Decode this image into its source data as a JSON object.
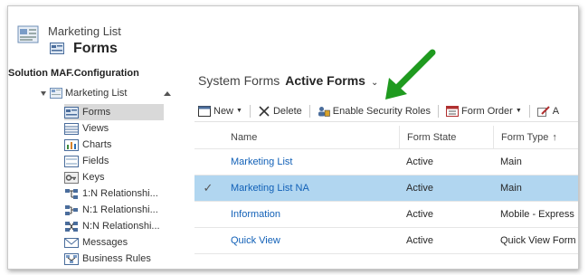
{
  "header": {
    "breadcrumb": "Marketing List",
    "title": "Forms"
  },
  "nav": {
    "solution_label": "Solution MAF.Configuration",
    "root_label": "Marketing List",
    "items": [
      {
        "label": "Forms",
        "icon": "forms-icon",
        "selected": true
      },
      {
        "label": "Views",
        "icon": "views-icon"
      },
      {
        "label": "Charts",
        "icon": "charts-icon"
      },
      {
        "label": "Fields",
        "icon": "fields-icon"
      },
      {
        "label": "Keys",
        "icon": "keys-icon"
      },
      {
        "label": "1:N Relationshi...",
        "icon": "relationship-icon"
      },
      {
        "label": "N:1 Relationshi...",
        "icon": "relationship-icon"
      },
      {
        "label": "N:N Relationshi...",
        "icon": "relationship-icon"
      },
      {
        "label": "Messages",
        "icon": "messages-icon"
      },
      {
        "label": "Business Rules",
        "icon": "business-rules-icon"
      }
    ]
  },
  "main": {
    "system_label": "System Forms",
    "view_label": "Active Forms",
    "toolbar": {
      "new_label": "New",
      "delete_label": "Delete",
      "security_label": "Enable Security Roles",
      "order_label": "Form Order",
      "overflow_label": "A"
    },
    "columns": {
      "name": "Name",
      "state": "Form State",
      "type": "Form Type"
    },
    "rows": [
      {
        "name": "Marketing List",
        "state": "Active",
        "type": "Main"
      },
      {
        "name": "Marketing List NA",
        "state": "Active",
        "type": "Main",
        "selected": true
      },
      {
        "name": "Information",
        "state": "Active",
        "type": "Mobile - Express"
      },
      {
        "name": "Quick View",
        "state": "Active",
        "type": "Quick View Form"
      }
    ]
  },
  "colors": {
    "selected_row": "#b1d6f0",
    "link": "#1160b7",
    "annotation_arrow": "#1f9a1f"
  }
}
